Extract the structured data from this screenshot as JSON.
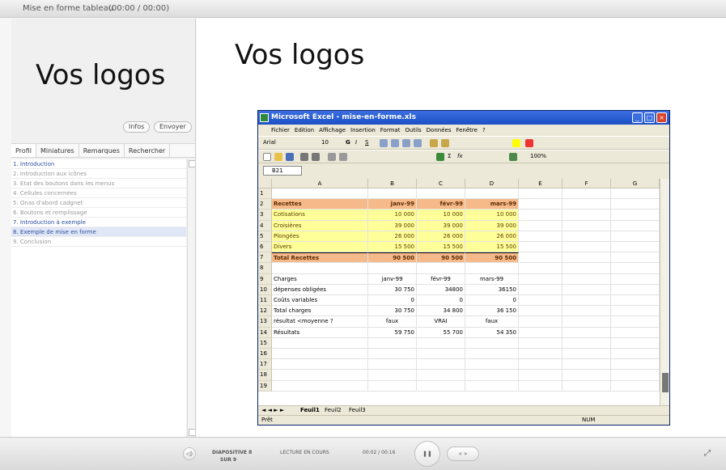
{
  "window": {
    "title": "Mise en forme tableau",
    "time": "(00:00 / 00:00)"
  },
  "left": {
    "logo": "Vos logos",
    "info_btn": "Infos",
    "send_btn": "Envoyer",
    "tabs": [
      "Profil",
      "Miniatures",
      "Remarques",
      "Rechercher"
    ],
    "items": [
      {
        "label": "1. Introduction",
        "state": "active"
      },
      {
        "label": "2. Introduction aux icônes",
        "state": "dim"
      },
      {
        "label": "3. Etat des boutons dans les menus",
        "state": "dim"
      },
      {
        "label": "4. Cellules concernées",
        "state": "dim"
      },
      {
        "label": "5. Onas d'abord cadgnet",
        "state": "dim"
      },
      {
        "label": "6. Boutons et remplissage",
        "state": "dim"
      },
      {
        "label": "7. Introduction à exemple",
        "state": "active"
      },
      {
        "label": "8. Exemple de mise en forme",
        "state": "selected"
      },
      {
        "label": "9. Conclusion",
        "state": "dim"
      }
    ]
  },
  "slide": {
    "logo": "Vos logos"
  },
  "excel": {
    "title": "Microsoft Excel - mise-en-forme.xls",
    "menu": [
      "Fichier",
      "Edition",
      "Affichage",
      "Insertion",
      "Format",
      "Outils",
      "Données",
      "Fenêtre",
      "?"
    ],
    "font": "Arial",
    "size": "10",
    "zoom": "100%",
    "cellref": "B21",
    "columns": [
      "A",
      "B",
      "C",
      "D",
      "E",
      "F",
      "G"
    ],
    "rows": [
      [
        "",
        "",
        "",
        ""
      ],
      [
        "Recettes",
        "janv-99",
        "févr-99",
        "mars-99"
      ],
      [
        "Cotisations",
        "10 000",
        "10 000",
        "10 000"
      ],
      [
        "Croisières",
        "39 000",
        "39 000",
        "39 000"
      ],
      [
        "Plongées",
        "26 000",
        "26 000",
        "26 000"
      ],
      [
        "Divers",
        "15 500",
        "15 500",
        "15 500"
      ],
      [
        "Total Recettes",
        "90 500",
        "90 500",
        "90 500"
      ],
      [
        "",
        "",
        "",
        ""
      ],
      [
        "Charges",
        "janv-99",
        "févr-99",
        "mars-99"
      ],
      [
        "dépenses obligées",
        "30 750",
        "34800",
        "36150"
      ],
      [
        "Coûts variables",
        "0",
        "0",
        "0"
      ],
      [
        "Total charges",
        "30 750",
        "34 800",
        "36 150"
      ],
      [
        "résultat <moyenne ?",
        "faux",
        "VRAI",
        "faux"
      ],
      [
        "Résultats",
        "59 750",
        "55 700",
        "54 350"
      ],
      [
        "",
        "",
        "",
        ""
      ],
      [
        "",
        "",
        "",
        ""
      ],
      [
        "",
        "",
        "",
        ""
      ],
      [
        "",
        "",
        "",
        ""
      ],
      [
        "",
        "",
        "",
        ""
      ]
    ],
    "sheets": [
      "Feuil1",
      "Feuil2",
      "Feuil3"
    ],
    "status_left": "Prêt",
    "status_num": "NUM"
  },
  "player": {
    "slide_label": "DIAPOSITIVE 8",
    "slide_sub": "SUR 9",
    "state": "LECTURE EN COURS",
    "time": "00:02 / 00:16"
  },
  "colors": {
    "header_orange": "#f6b98a",
    "yellow": "#ffff99",
    "row_blue": "#2d4f9e",
    "selected_bg": "#dfe7f6"
  }
}
